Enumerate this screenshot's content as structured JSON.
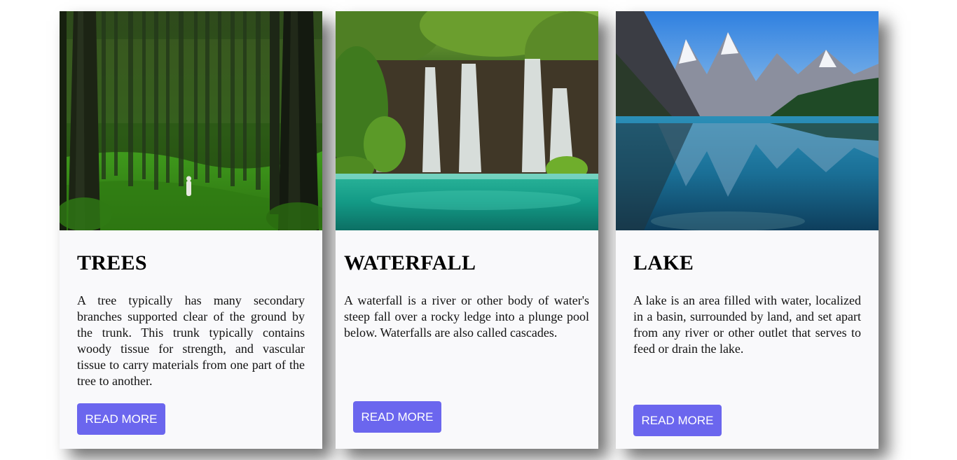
{
  "cards": [
    {
      "title": "TREES",
      "text": "A tree typically has many secondary branches supported clear of the ground by the trunk. This trunk typically contains woody tissue for strength, and vascular tissue to carry materials from one part of the tree to another.",
      "button_label": "READ MORE",
      "image": "forest-photo"
    },
    {
      "title": "WATERFALL",
      "text": "A waterfall is a river or other body of water's steep fall over a rocky ledge into a plunge pool below. Waterfalls are also called cascades.",
      "button_label": "READ MORE",
      "image": "waterfall-photo"
    },
    {
      "title": "LAKE",
      "text": "A lake is an area filled with water, localized in a basin, surrounded by land, and set apart from any river or other outlet that serves to feed or drain the lake.",
      "button_label": "READ MORE",
      "image": "mountain-lake-photo"
    }
  ],
  "colors": {
    "button": "#6b66ee",
    "card_background": "#f9f9fb",
    "button_text": "#ffffff"
  }
}
